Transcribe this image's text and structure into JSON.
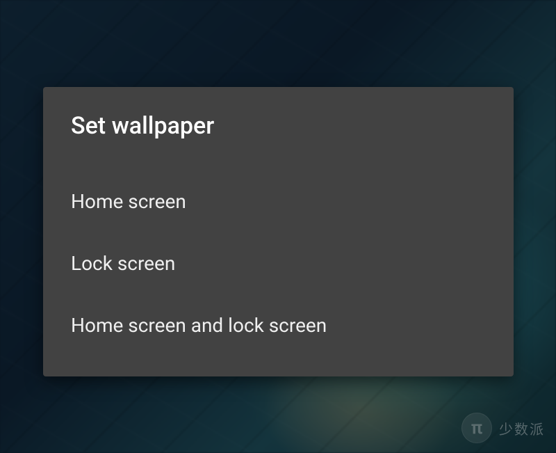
{
  "dialog": {
    "title": "Set wallpaper",
    "options": [
      {
        "label": "Home screen"
      },
      {
        "label": "Lock screen"
      },
      {
        "label": "Home screen and lock screen"
      }
    ]
  },
  "watermark": {
    "icon_glyph": "π",
    "text": "少数派"
  }
}
